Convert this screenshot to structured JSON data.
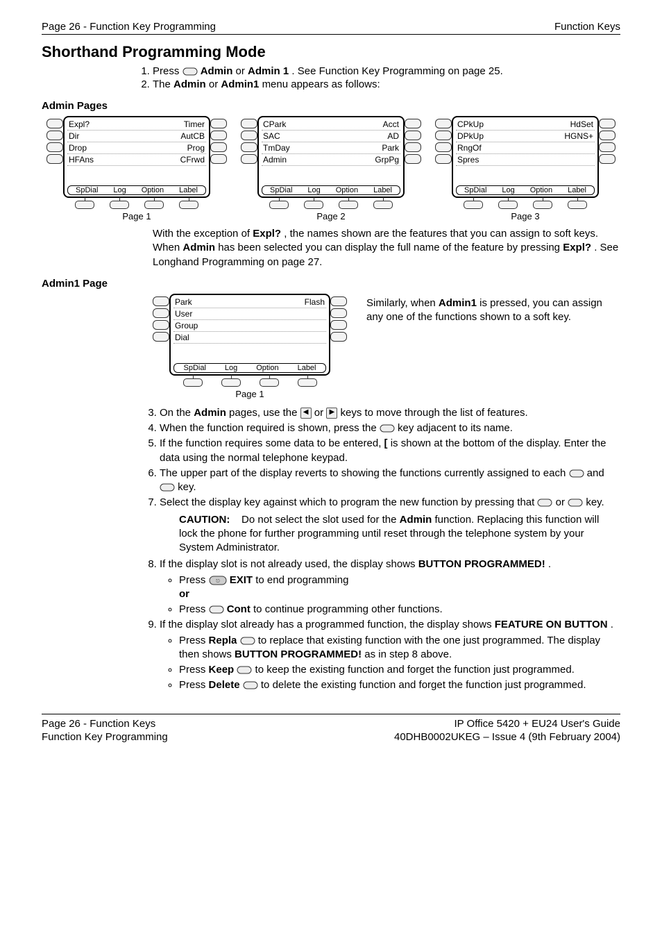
{
  "header": {
    "left": "Page 26 - Function Key Programming",
    "right": "Function Keys"
  },
  "title": "Shorthand Programming Mode",
  "intro": {
    "step1_a": "Press ",
    "step1_b": " Admin",
    "step1_c": " or ",
    "step1_d": "Admin 1",
    "step1_e": ". See Function Key Programming on page 25.",
    "step2_a": "The ",
    "step2_b": "Admin",
    "step2_c": " or ",
    "step2_d": "Admin1",
    "step2_e": " menu appears as follows:"
  },
  "admin_pages_label": "Admin Pages",
  "pages": [
    {
      "caption": "Page 1",
      "rows": [
        {
          "l": "Expl?",
          "r": "Timer"
        },
        {
          "l": "Dir",
          "r": "AutCB"
        },
        {
          "l": "Drop",
          "r": "Prog"
        },
        {
          "l": "HFAns",
          "r": "CFrwd"
        }
      ],
      "soft": [
        "SpDial",
        "Log",
        "Option",
        "Label"
      ]
    },
    {
      "caption": "Page 2",
      "rows": [
        {
          "l": "CPark",
          "r": "Acct"
        },
        {
          "l": "SAC",
          "r": "AD"
        },
        {
          "l": "TmDay",
          "r": "Park"
        },
        {
          "l": "Admin",
          "r": "GrpPg"
        }
      ],
      "soft": [
        "SpDial",
        "Log",
        "Option",
        "Label"
      ]
    },
    {
      "caption": "Page 3",
      "rows": [
        {
          "l": "CPkUp",
          "r": "HdSet"
        },
        {
          "l": "DPkUp",
          "r": "HGNS+"
        },
        {
          "l": "RngOf",
          "r": ""
        },
        {
          "l": "Spres",
          "r": ""
        }
      ],
      "soft": [
        "SpDial",
        "Log",
        "Option",
        "Label"
      ]
    }
  ],
  "note1": {
    "a": "With the exception of ",
    "b": "Expl?",
    "c": ", the names shown are the features that you can assign to soft keys. When ",
    "d": "Admin",
    "e": " has been selected you can display the full name of the feature by pressing ",
    "f": "Expl?",
    "g": ". See Longhand Programming on page 27."
  },
  "admin1_label": "Admin1 Page",
  "admin1_page": {
    "caption": "Page 1",
    "rows": [
      {
        "l": "Park",
        "r": "Flash"
      },
      {
        "l": "User",
        "r": ""
      },
      {
        "l": "Group",
        "r": ""
      },
      {
        "l": "Dial",
        "r": ""
      }
    ],
    "soft": [
      "SpDial",
      "Log",
      "Option",
      "Label"
    ]
  },
  "admin1_side": {
    "a": "Similarly, when ",
    "b": "Admin1",
    "c": " is pressed, you can assign any one of the functions shown to a soft key."
  },
  "steps": {
    "s3_a": "On the ",
    "s3_b": "Admin",
    "s3_c": " pages, use the ",
    "s3_d": " or ",
    "s3_e": " keys to move through the list of features.",
    "s4_a": "When the function required is shown, press the ",
    "s4_b": " key adjacent to its name.",
    "s5_a": "If the function requires some data to be entered, ",
    "s5_b": "[",
    "s5_c": " is shown at the bottom of the display. Enter the data using the normal telephone keypad.",
    "s6_a": "The upper part of the display reverts to showing the functions currently assigned to each ",
    "s6_b": " and ",
    "s6_c": " key.",
    "s7_a": "Select the display key against which to program the new function by pressing that ",
    "s7_b": " or ",
    "s7_c": " key.",
    "caution_hd": "CAUTION:",
    "caution_body_a": "Do not select the slot used for the ",
    "caution_body_b": "Admin",
    "caution_body_c": " function. Replacing this function will lock the phone for further programming until reset through the telephone system by your System Administrator.",
    "s8_a": "If the display slot is not already used, the display shows ",
    "s8_b": "BUTTON PROGRAMMED!",
    "s8_c": ".",
    "s8_bul1_a": "Press ",
    "s8_bul1_b": " EXIT",
    "s8_bul1_c": " to end programming",
    "s8_or": "or",
    "s8_bul2_a": "Press ",
    "s8_bul2_b": " Cont",
    "s8_bul2_c": " to continue programming other functions.",
    "s9_a": "If the display slot already has a programmed function, the display shows ",
    "s9_b": "FEATURE ON BUTTON",
    "s9_c": ".",
    "s9_bul1_a": "Press ",
    "s9_bul1_b": "Repla",
    "s9_bul1_c": " to replace that existing function with the one just programmed. The display then shows ",
    "s9_bul1_d": "BUTTON PROGRAMMED!",
    "s9_bul1_e": " as in step 8 above.",
    "s9_bul2_a": "Press ",
    "s9_bul2_b": "Keep",
    "s9_bul2_c": " to keep the existing function and forget the function just programmed.",
    "s9_bul3_a": "Press ",
    "s9_bul3_b": "Delete",
    "s9_bul3_c": " to delete the existing function and forget the function just programmed."
  },
  "footer": {
    "l1": "Page 26 - Function Keys",
    "l2": "Function Key Programming",
    "r1": "IP Office 5420 + EU24 User's Guide",
    "r2": "40DHB0002UKEG – Issue 4 (9th February 2004)"
  }
}
